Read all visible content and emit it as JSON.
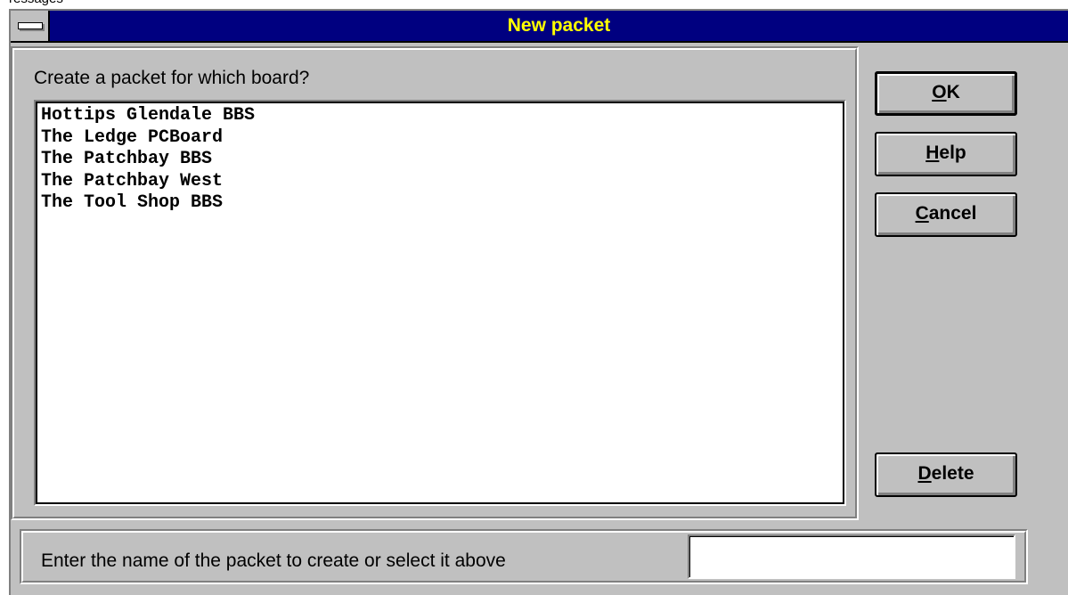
{
  "background_text": "ressages",
  "dialog": {
    "title": "New packet",
    "prompt": "Create a packet for which board?",
    "boards": [
      "Hottips Glendale BBS",
      "The Ledge PCBoard",
      "The Patchbay BBS",
      "The Patchbay West",
      "The Tool Shop BBS"
    ],
    "buttons": {
      "ok": {
        "mnemonic": "O",
        "rest": "K"
      },
      "help": {
        "mnemonic": "H",
        "rest": "elp"
      },
      "cancel": {
        "mnemonic": "C",
        "rest": "ancel"
      },
      "delete": {
        "mnemonic": "D",
        "rest": "elete"
      }
    },
    "name_label": "Enter the name of the packet to create or select it above",
    "name_value": ""
  },
  "colors": {
    "face": "#c0c0c0",
    "titlebar": "#000080",
    "title_text": "#ffff00"
  },
  "icons": {
    "system_menu": "system-menu-icon"
  }
}
